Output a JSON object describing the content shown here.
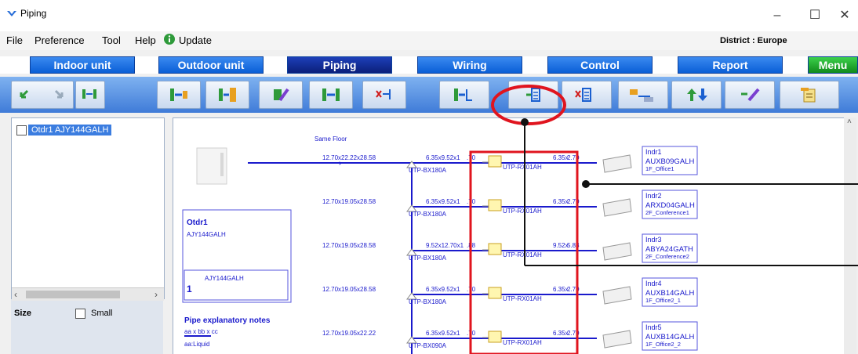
{
  "window": {
    "title": "Piping",
    "min": "–",
    "max": "☐",
    "close": "✕"
  },
  "menu": {
    "items": [
      "File",
      "Preference",
      "Tool",
      "Help",
      "Update"
    ],
    "district": "District : Europe"
  },
  "tabs": [
    "Indoor unit",
    "Outdoor unit",
    "Piping",
    "Wiring",
    "Control",
    "Report",
    "Menu"
  ],
  "active_tab": "Piping",
  "tree": {
    "item": "Otdr1 AJY144GALH"
  },
  "left_panel": {
    "size_label": "Size",
    "small_label": "Small"
  },
  "diagram": {
    "same_floor": "Same Floor",
    "outdoor": {
      "name": "Otdr1",
      "model": "AJY144GALH",
      "box_model": "AJY144GALH",
      "box_count": "1"
    },
    "notes": {
      "title": "Pipe explanatory notes",
      "line1": "aa x bb x cc",
      "line2": "aa:Liquid"
    },
    "rows": [
      {
        "main_size": "12.70x22.22x28.58",
        "branch": "UTP-BX180A",
        "left_size": "6.35x9.52x1",
        "left_tail": ".70",
        "kit": "UTP-RX01AH",
        "right_size": "6.35x",
        "right_tail": "2.70",
        "unit_name": "Indr1",
        "unit_model": "AUXB09GALH",
        "unit_loc": "1F_Office1"
      },
      {
        "main_size": "12.70x19.05x28.58",
        "branch": "UTP-BX180A",
        "left_size": "6.35x9.52x1",
        "left_tail": ".70",
        "kit": "UTP-RX01AH",
        "right_size": "6.35x",
        "right_tail": "2.70",
        "unit_name": "Indr2",
        "unit_model": "ARXD04GALH",
        "unit_loc": "2F_Conference1"
      },
      {
        "main_size": "12.70x19.05x28.58",
        "branch": "UTP-BX180A",
        "left_size": "9.52x12.70x1",
        "left_tail": ".88",
        "kit": "UTP-RX01AH",
        "right_size": "9.52x",
        "right_tail": "5.88",
        "unit_name": "Indr3",
        "unit_model": "ABYA24GATH",
        "unit_loc": "2F_Conference2"
      },
      {
        "main_size": "12.70x19.05x28.58",
        "branch": "UTP-BX180A",
        "left_size": "6.35x9.52x1",
        "left_tail": ".70",
        "kit": "UTP-RX01AH",
        "right_size": "6.35x",
        "right_tail": "2.70",
        "unit_name": "Indr4",
        "unit_model": "AUXB14GALH",
        "unit_loc": "1F_Office2_1"
      },
      {
        "main_size": "12.70x19.05x22.22",
        "branch": "UTP-BX090A",
        "left_size": "6.35x9.52x1",
        "left_tail": ".70",
        "kit": "UTP-RX01AH",
        "right_size": "6.35x",
        "right_tail": "2.70",
        "unit_name": "Indr5",
        "unit_model": "AUXB14GALH",
        "unit_loc": "1F_Office2_2"
      }
    ]
  },
  "colors": {
    "pipe": "#1a1acc",
    "text_blue": "#1a1acc",
    "annotation_red": "#e0141e",
    "tab_blue": "#0a5fd6",
    "tab_active": "#0b1f7a",
    "tab_menu": "#20a82c",
    "toolbar_bg": "#5b93e3"
  },
  "toolbar_icons": [
    "undo-icon",
    "redo-icon",
    "pipe-connect-icon",
    "copy-pipe-icon",
    "paste-pipe-icon",
    "add-unit-icon",
    "swap-units-icon",
    "delete-pipe-icon",
    "insert-branch-icon",
    "insert-kit-icon",
    "delete-kit-icon",
    "move-units-icon",
    "up-down-icon",
    "check-icon",
    "report-icon"
  ]
}
